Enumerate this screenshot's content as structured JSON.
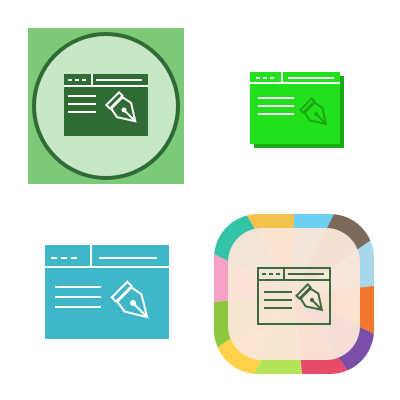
{
  "icons": [
    {
      "name": "pen-tool-window-icon",
      "style": "green-circle-badge",
      "colors": {
        "tile": "#7dc97a",
        "ring_fill": "#c8e7c7",
        "ring_stroke": "#2f6b32",
        "window": "#2f6b32",
        "line": "#ffffff"
      }
    },
    {
      "name": "pen-tool-window-icon",
      "style": "bright-green-flat",
      "colors": {
        "window": "#22e01c",
        "shadow": "#1aa815",
        "line": "#ffffff"
      }
    },
    {
      "name": "pen-tool-window-icon",
      "style": "teal-flat",
      "colors": {
        "window": "#3fb7c8",
        "line": "#ffffff"
      }
    },
    {
      "name": "pen-tool-window-icon",
      "style": "multicolor-rounded-badge",
      "colors": {
        "inner": "#fbe7d9",
        "line": "#3d6b3d",
        "segments": [
          "#f2c14e",
          "#6fcff0",
          "#7b6a5b",
          "#f0772c",
          "#34c3a6",
          "#7c4ea7",
          "#f7a1c4",
          "#8dc63f",
          "#ffd24a",
          "#e64b6a",
          "#a7d7e8",
          "#b5e35a"
        ]
      }
    }
  ]
}
